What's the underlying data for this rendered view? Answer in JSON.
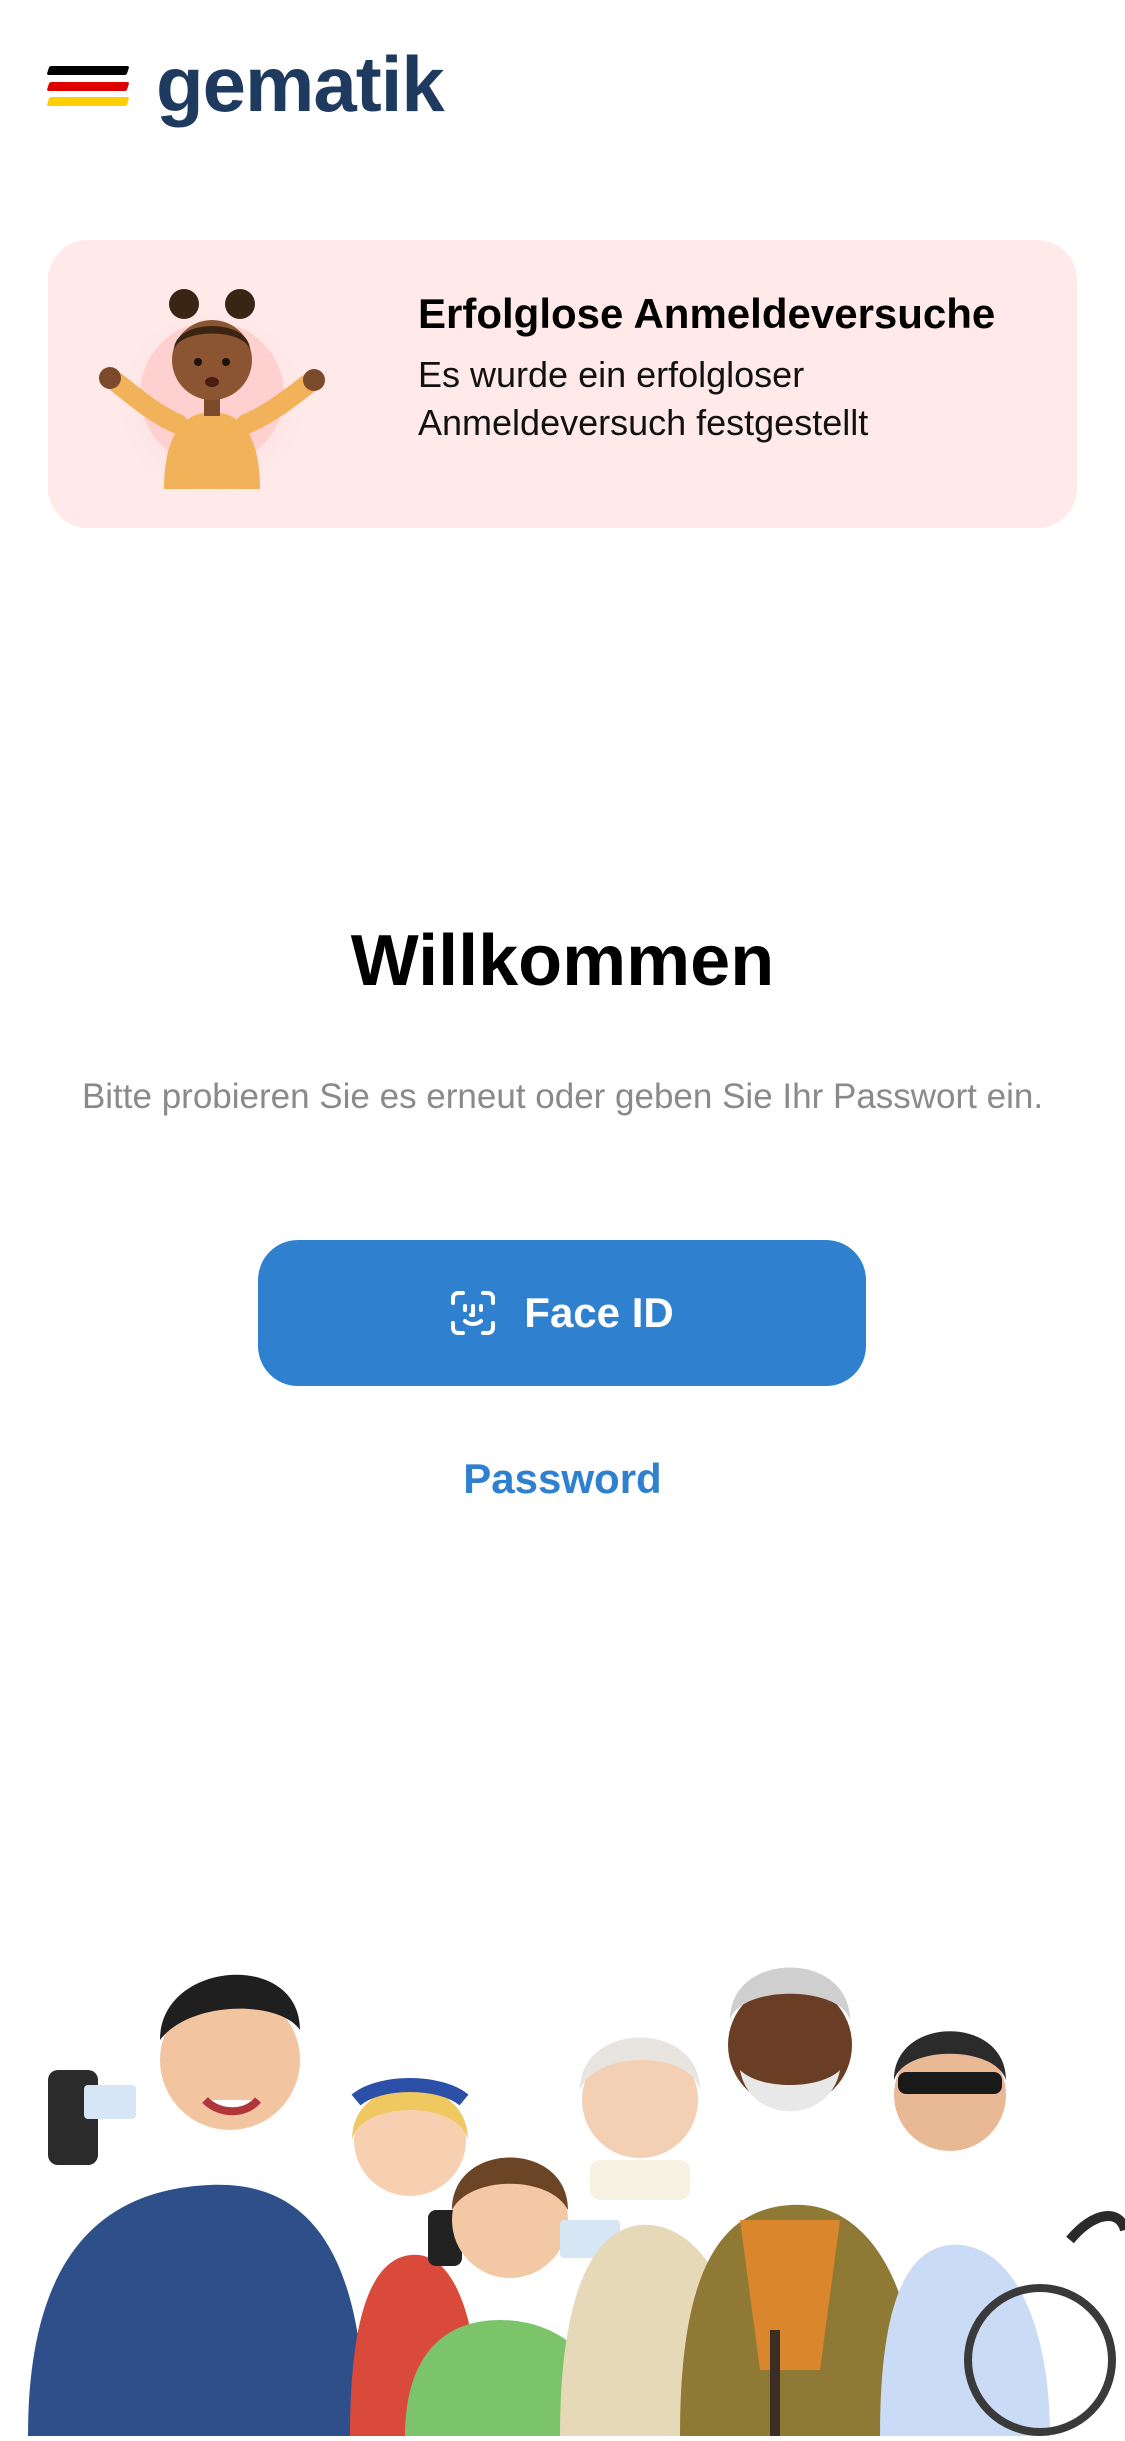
{
  "header": {
    "logo_text": "gematik",
    "logo_color": "#1e3a5f",
    "flag_colors": [
      "#000000",
      "#dd0000",
      "#ffce00"
    ]
  },
  "alert": {
    "title": "Erfolglose Anmeldeversuche",
    "body_line1": "Es wurde ein erfolgloser",
    "body_line2": "Anmeldeversuch festgestellt",
    "background": "#ffe9e9",
    "illustration_icon": "shrugging-person-illustration"
  },
  "welcome": {
    "title": "Willkommen",
    "subtitle": "Bitte probieren Sie es erneut oder geben Sie Ihr Passwort ein."
  },
  "actions": {
    "face_id_label": "Face ID",
    "face_id_icon": "face-id-icon",
    "password_label": "Password",
    "accent_color": "#2f80cf"
  },
  "footer": {
    "illustration_icon": "group-of-people-illustration"
  }
}
